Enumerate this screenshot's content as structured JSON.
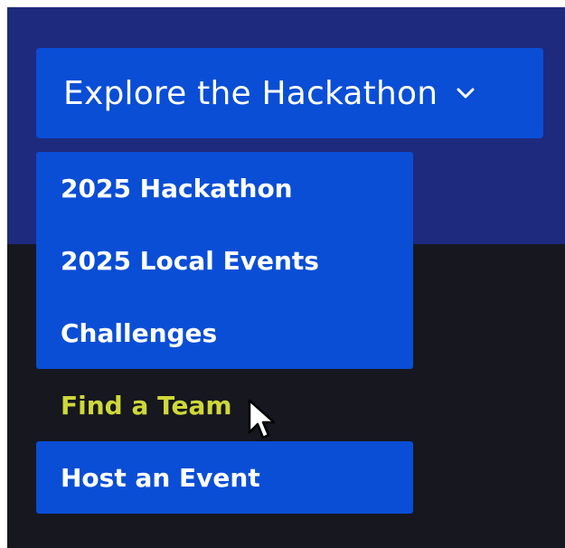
{
  "explore_button": {
    "label": "Explore the Hackathon",
    "icon": "chevron-down-icon"
  },
  "menu": {
    "items": [
      {
        "label": "2025 Hackathon",
        "state": "default"
      },
      {
        "label": "2025 Local Events",
        "state": "default"
      },
      {
        "label": "Challenges",
        "state": "default"
      },
      {
        "label": "Find a Team",
        "state": "hovered"
      },
      {
        "label": "Host an Event",
        "state": "default"
      }
    ]
  },
  "colors": {
    "hero_background": "#1e2a7d",
    "page_background": "#16171f",
    "button_blue": "#0a4ed6",
    "hover_text": "#cfd83a",
    "text": "#ffffff"
  },
  "cursor": {
    "icon": "mouse-pointer-icon"
  }
}
